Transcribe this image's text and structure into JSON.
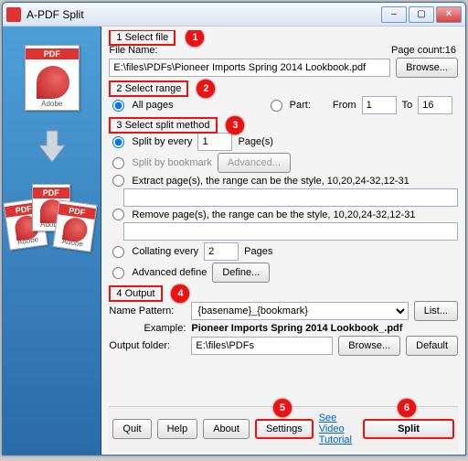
{
  "window": {
    "title": "A-PDF Split"
  },
  "section1": {
    "heading": "1 Select file",
    "file_name_label": "File Name:",
    "file_name": "E:\\files\\PDFs\\Pioneer Imports Spring 2014 Lookbook.pdf",
    "page_count_label": "Page count:16",
    "browse": "Browse..."
  },
  "section2": {
    "heading": "2 Select range",
    "all_pages": "All pages",
    "part": "Part:",
    "from_label": "From",
    "from_val": "1",
    "to_label": "To",
    "to_val": "16"
  },
  "section3": {
    "heading": "3 Select split method",
    "split_every": "Split by every",
    "split_every_val": "1",
    "pages_suffix": "Page(s)",
    "split_bookmark": "Split by bookmark",
    "advanced": "Advanced...",
    "extract": "Extract page(s), the range can be the style, 10,20,24-32,12-31",
    "remove": "Remove page(s), the range can be the style, 10,20,24-32,12-31",
    "collating": "Collating every",
    "collating_val": "2",
    "collating_suffix": "Pages",
    "advanced_define": "Advanced define",
    "define": "Define..."
  },
  "section4": {
    "heading": "4 Output",
    "name_pattern_label": "Name Pattern:",
    "name_pattern": "{basename}_{bookmark}",
    "list": "List...",
    "example_label": "Example:",
    "example": "Pioneer Imports Spring 2014 Lookbook_.pdf",
    "output_folder_label": "Output folder:",
    "output_folder": "E:\\files\\PDFs",
    "browse": "Browse...",
    "default": "Default"
  },
  "footer": {
    "quit": "Quit",
    "help": "Help",
    "about": "About",
    "settings": "Settings",
    "tutorial": "See Video Tutorial",
    "split": "Split"
  },
  "callouts": {
    "n1": "1",
    "n2": "2",
    "n3": "3",
    "n4": "4",
    "n5": "5",
    "n6": "6"
  },
  "adobe": "Adobe"
}
